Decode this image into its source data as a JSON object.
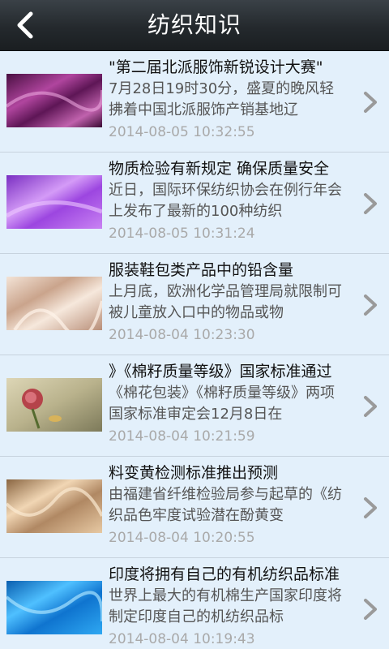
{
  "header": {
    "title": "纺织知识",
    "back_icon": "back-arrow-icon"
  },
  "articles": [
    {
      "headline": "\"第二届北派服饰新锐设计大赛\"",
      "summary": "7月28日19时30分，盛夏的晚风轻拂着中国北派服饰产销基地辽",
      "date": "2014-08-05 10:32:55",
      "thumb_color": "#8e2f7a"
    },
    {
      "headline": "物质检验有新规定 确保质量安全",
      "summary": "近日，国际环保纺织协会在例行年会上发布了最新的100种纺织",
      "date": "2014-08-05 10:31:24",
      "thumb_color": "#b469e8"
    },
    {
      "headline": "服装鞋包类产品中的铅含量",
      "summary": "上月底，欧洲化学品管理局就限制可被儿童放入口中的物品或物",
      "date": "2014-08-04 10:23:30",
      "thumb_color": "#e7cdb9"
    },
    {
      "headline": "》《棉籽质量等级》国家标准通过",
      "summary": "《棉花包装》《棉籽质量等级》两项国家标准审定会12月8日在",
      "date": "2014-08-04 10:21:59",
      "thumb_color": "#a4a076"
    },
    {
      "headline": "料变黄检测标准推出预测",
      "summary": "由福建省纤维检验局参与起草的《纺织品色牢度试验潜在酚黄变",
      "date": "2014-08-04 10:20:55",
      "thumb_color": "#d9b48c"
    },
    {
      "headline": "印度将拥有自己的有机纺织品标准",
      "summary": "世界上最大的有机棉生产国家印度将制定印度自己的机纺织品标",
      "date": "2014-08-04 10:19:43",
      "thumb_color": "#1d8fe0"
    }
  ]
}
